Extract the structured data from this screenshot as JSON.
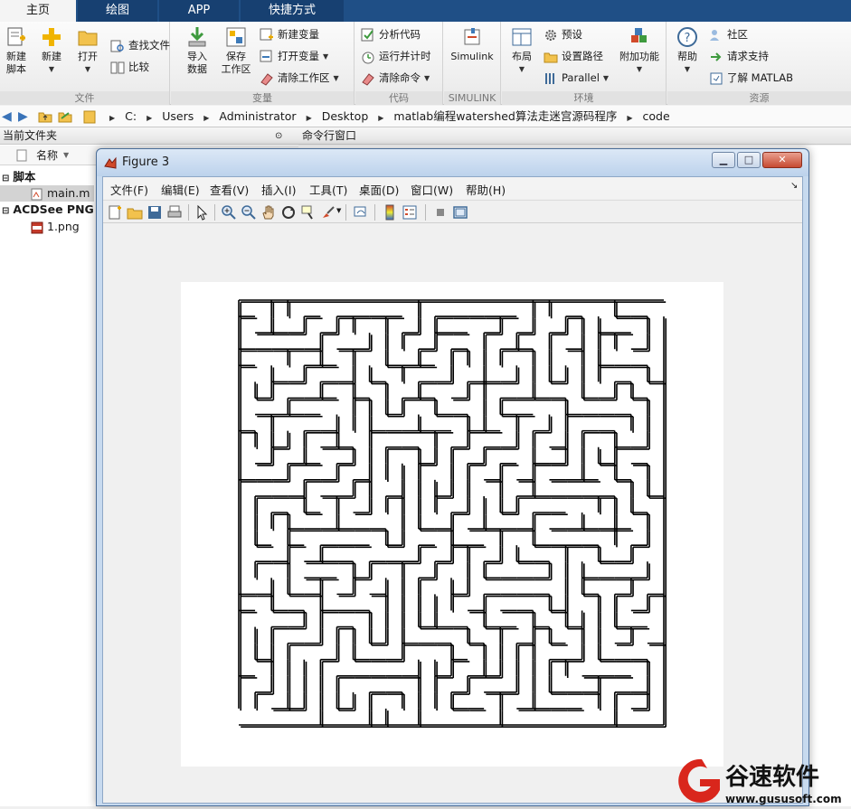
{
  "ribbon": {
    "tabs": [
      "主页",
      "绘图",
      "APP",
      "快捷方式"
    ],
    "groups": {
      "file": {
        "label": "文件",
        "new_script": "新建\n脚本",
        "new": "新建",
        "open": "打开",
        "find_files": "查找文件",
        "compare": "比较"
      },
      "variable": {
        "label": "变量",
        "import_data": "导入\n数据",
        "save_workspace": "保存\n工作区",
        "new_variable": "新建变量",
        "open_variable": "打开变量",
        "clear_workspace": "清除工作区"
      },
      "code": {
        "label": "代码",
        "analyze_code": "分析代码",
        "run_and_time": "运行并计时",
        "clear_commands": "清除命令"
      },
      "simulink": {
        "label": "SIMULINK",
        "simulink": "Simulink"
      },
      "environment": {
        "label": "环境",
        "layout": "布局",
        "preferences": "预设",
        "set_path": "设置路径",
        "parallel": "Parallel",
        "addons": "附加功能"
      },
      "resources": {
        "label": "资源",
        "help": "帮助",
        "community": "社区",
        "request_support": "请求支持",
        "learn_matlab": "了解 MATLAB"
      }
    }
  },
  "address": {
    "crumbs": [
      "C:",
      "Users",
      "Administrator",
      "Desktop",
      "matlab编程watershed算法走迷宫源码程序",
      "code"
    ]
  },
  "left_panel": {
    "title": "当前文件夹",
    "column_name": "名称",
    "groups": [
      {
        "label": "脚本",
        "items": [
          "main.m"
        ]
      },
      {
        "label": "ACDSee PNG 图",
        "items": [
          "1.png"
        ]
      }
    ]
  },
  "command_window": {
    "title": "命令行窗口"
  },
  "figure": {
    "title": "Figure 3",
    "menu": [
      "文件(F)",
      "编辑(E)",
      "查看(V)",
      "插入(I)",
      "工具(T)",
      "桌面(D)",
      "窗口(W)",
      "帮助(H)"
    ],
    "corner_arrow": "↘"
  },
  "watermark": {
    "brand": "谷速软件",
    "url": "www.gususoft.com"
  },
  "colors": {
    "tabbar": "#1f4f86",
    "ribbon_bg": "#f4f4f4",
    "figure_frame": "#c7daef",
    "watermark_red": "#d9261c"
  }
}
